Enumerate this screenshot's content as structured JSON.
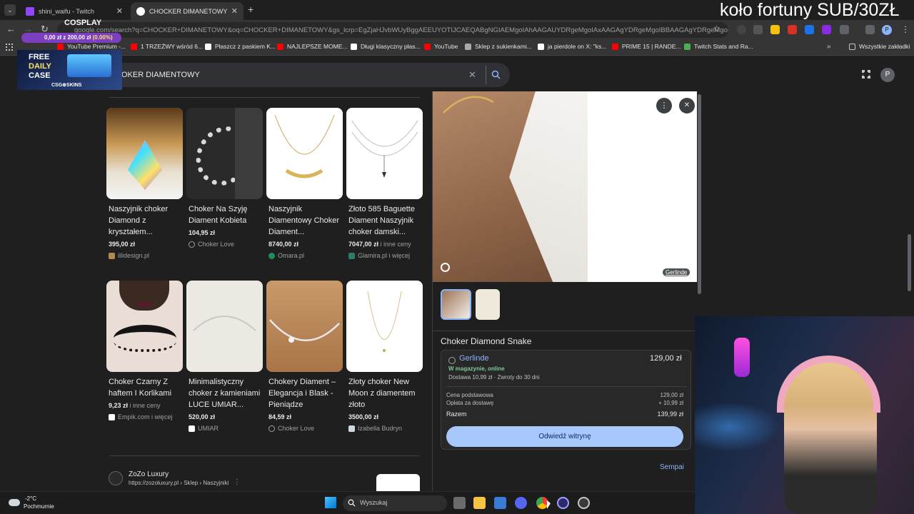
{
  "tabs": [
    {
      "title": "shini_waifu - Twitch",
      "active": false
    },
    {
      "title": "CHOCKER DIMANETOWY - Szuk",
      "active": true
    }
  ],
  "address": {
    "url": "google.com/search?q=CHOCKER+DIMANETOWY&oq=CHOCKER+DIMANETOWY&gs_lcrp=EgZjaHJvbWUyBggAEEUYOTIJCAEQABgNGIAEMgoIAhAAGAUYDRgeMgoIAxAAGAgYDRgeMgoIBBAAGAgYDRgeMgoIBRAA"
  },
  "overlay": {
    "cosplay_label": "COSPLAY",
    "progress_text": "0,00 zł z 200,00 zł",
    "progress_percent": "(0.00%)",
    "progress_fraction": 0.0,
    "top_right_text": "koło fortuny SUB/30ZŁ",
    "daily_case_line1": "FREE",
    "daily_case_line2": "DAILY",
    "daily_case_line3": "CASE",
    "daily_case_brand": "CSG⊕SKINS"
  },
  "bookmarks": [
    "YouTube Premium -...",
    "1 TRZEŹWY wśród 6...",
    "Płaszcz z paskiem K...",
    "NAJLEPSZE MOME...",
    "Długi klasyczny płas...",
    "YouTube",
    "Sklep z sukienkami...",
    "ja pierdole on X: \"ks...",
    "PRIME 15 | RANDE...",
    "Twitch Stats and Ra...",
    "Wszystkie zakładki"
  ],
  "search": {
    "query": "OKER DIAMENTOWY",
    "avatar_letter": "P"
  },
  "results": [
    {
      "title": "Naszyjnik choker Diamond z kryształem...",
      "price": "395,00 zł",
      "extra": "",
      "seller": "illidesign.pl"
    },
    {
      "title": "Choker Na Szyję Diament Kobieta",
      "price": "104,95 zł",
      "extra": "",
      "seller": "Choker Love"
    },
    {
      "title": "Naszyjnik Diamentowy Choker Diament...",
      "price": "8740,00 zł",
      "extra": "",
      "seller": "Omara.pl"
    },
    {
      "title": "Złoto 585 Baguette Diament Naszyjnik choker damski...",
      "price": "7047,00 zł",
      "extra": " i inne ceny",
      "seller": "Glamira.pl i więcej"
    },
    {
      "title": "Choker Czarny Z haftem I Korlikami",
      "price": "9,23 zł",
      "extra": " i inne ceny",
      "seller": "Empik.com i więcej"
    },
    {
      "title": "Minimalistyczny choker z kamieniami LUCE UMIAR...",
      "price": "520,00 zł",
      "extra": "",
      "seller": "UMIAR"
    },
    {
      "title": "Chokery Diament – Elegancja i Blask - Pieniądze",
      "price": "84,59 zł",
      "extra": "",
      "seller": "Choker Love"
    },
    {
      "title": "Złoty choker New Moon z diamentem złoto",
      "price": "3500,00 zł",
      "extra": "",
      "seller": "Izabella Budryn"
    }
  ],
  "web_result": {
    "site": "ZoZo Luxury",
    "url": "https://zozoluxury.pl › Sklep › Naszyjniki"
  },
  "panel": {
    "source_badge": "Gerlinde",
    "product_title": "Choker Diamond Snake",
    "seller": "Gerlinde",
    "price": "129,00 zł",
    "stock": "W magazynie, online",
    "delivery": "Dostawa 10,99 zł · Zwroty do 30 dni",
    "base_label": "Cena podstawowa",
    "base_value": "129,00 zł",
    "shipping_label": "Opłata za dostawę",
    "shipping_value": "+ 10,99 zł",
    "total_label": "Razem",
    "total_value": "139,99 zł",
    "visit_button": "Odwiedź witrynę",
    "more_link": "Sempai"
  },
  "taskbar": {
    "temp": "-2°C",
    "weather": "Pochmurnie",
    "search_placeholder": "Wyszukaj"
  }
}
